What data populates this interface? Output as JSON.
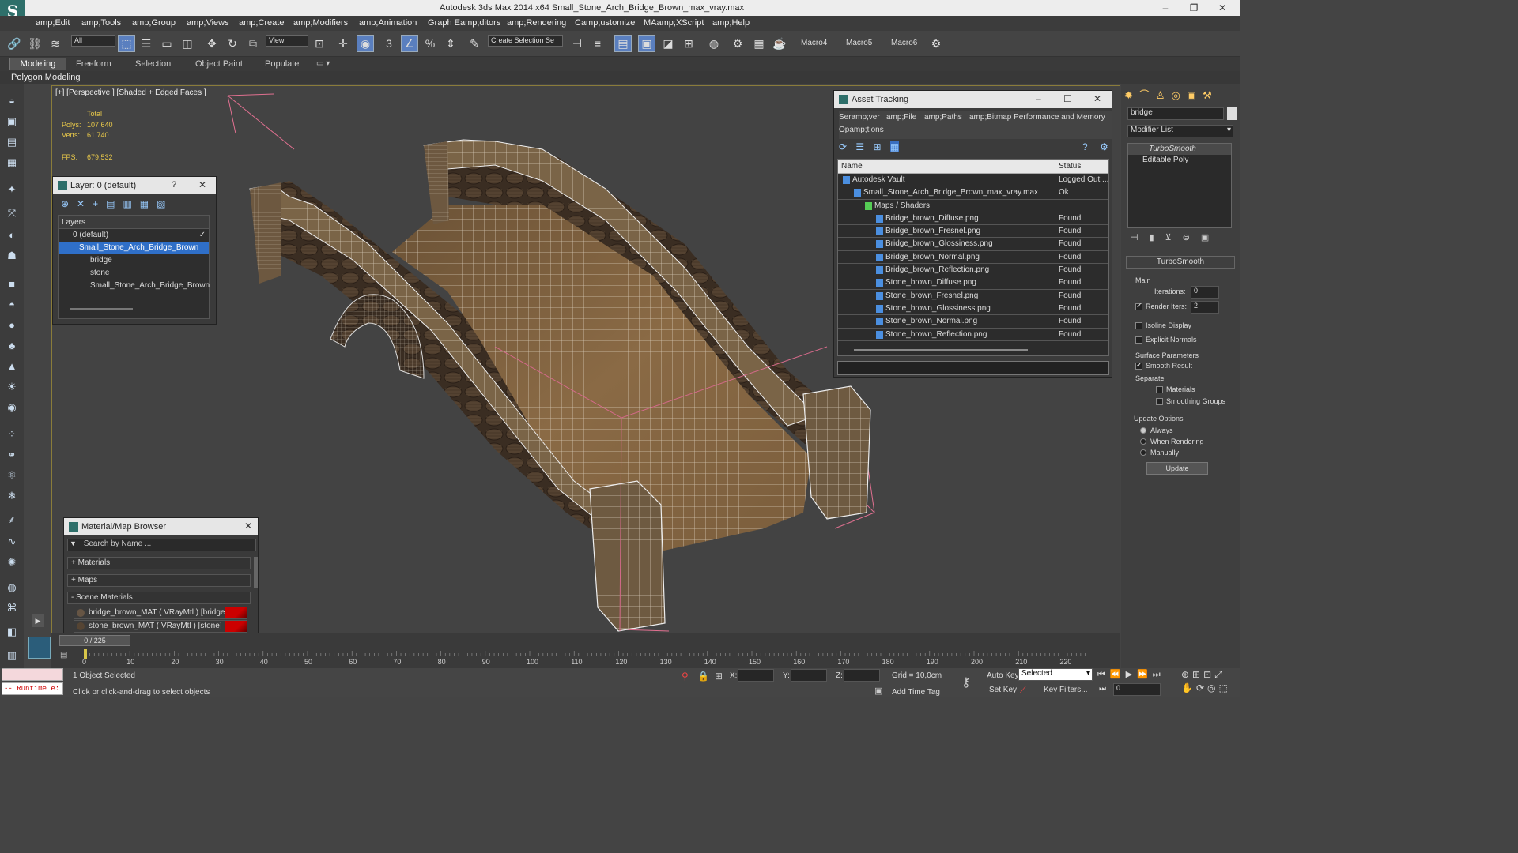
{
  "app": {
    "title": "Autodesk 3ds Max  2014 x64     Small_Stone_Arch_Bridge_Brown_max_vray.max"
  },
  "menu": [
    "amp;Edit",
    "amp;Tools",
    "amp;Group",
    "amp;Views",
    "amp;Create",
    "amp;Modifiers",
    "amp;Animation",
    "Graph Eamp;ditors",
    "amp;Rendering",
    "Camp;ustomize",
    "MAamp;XScript",
    "amp;Help"
  ],
  "toolbar": {
    "selection_filter": "All",
    "ref_coord": "View",
    "named_selection": "Create Selection Se",
    "macros": [
      "Macro4",
      "Macro5",
      "Macro6"
    ]
  },
  "ribbon": {
    "tabs": [
      "Modeling",
      "Freeform",
      "Selection",
      "Object Paint",
      "Populate"
    ],
    "sub": "Polygon Modeling"
  },
  "viewport": {
    "label": "[+] [Perspective ] [Shaded + Edged Faces ]",
    "total": "Total",
    "polys_label": "Polys:",
    "polys": "107 640",
    "verts_label": "Verts:",
    "verts": "61 740",
    "fps_label": "FPS:",
    "fps": "679,532"
  },
  "layer_dialog": {
    "title": "Layer: 0 (default)",
    "help": "?",
    "header": "Layers",
    "items": [
      "0 (default)",
      "Small_Stone_Arch_Bridge_Brown",
      "bridge",
      "stone",
      "Small_Stone_Arch_Bridge_Brown"
    ]
  },
  "material_browser": {
    "title": "Material/Map Browser",
    "search": "Search by Name ...",
    "groups": [
      "+ Materials",
      "+ Maps",
      "- Scene Materials"
    ],
    "materials": [
      "bridge_brown_MAT ( VRayMtl ) [bridge]",
      "stone_brown_MAT ( VRayMtl ) [stone]"
    ]
  },
  "asset_tracking": {
    "title": "Asset Tracking",
    "menu1": [
      "Seramp;ver",
      "amp;File",
      "amp;Paths",
      "amp;Bitmap Performance and Memory"
    ],
    "menu2": "Opamp;tions",
    "col_name": "Name",
    "col_status": "Status",
    "rows": [
      {
        "name": "Autodesk Vault",
        "status": "Logged Out ..."
      },
      {
        "name": "Small_Stone_Arch_Bridge_Brown_max_vray.max",
        "status": "Ok"
      },
      {
        "name": "Maps / Shaders",
        "status": ""
      },
      {
        "name": "Bridge_brown_Diffuse.png",
        "status": "Found"
      },
      {
        "name": "Bridge_brown_Fresnel.png",
        "status": "Found"
      },
      {
        "name": "Bridge_brown_Glossiness.png",
        "status": "Found"
      },
      {
        "name": "Bridge_brown_Normal.png",
        "status": "Found"
      },
      {
        "name": "Bridge_brown_Reflection.png",
        "status": "Found"
      },
      {
        "name": "Stone_brown_Diffuse.png",
        "status": "Found"
      },
      {
        "name": "Stone_brown_Fresnel.png",
        "status": "Found"
      },
      {
        "name": "Stone_brown_Glossiness.png",
        "status": "Found"
      },
      {
        "name": "Stone_brown_Normal.png",
        "status": "Found"
      },
      {
        "name": "Stone_brown_Reflection.png",
        "status": "Found"
      }
    ]
  },
  "command_panel": {
    "object_name": "bridge",
    "modifier_list": "Modifier List",
    "stack": [
      "TurboSmooth",
      "Editable Poly"
    ],
    "rollout": "TurboSmooth",
    "main": "Main",
    "iterations_label": "Iterations:",
    "iterations": "0",
    "render_iters_label": "Render Iters:",
    "render_iters": "2",
    "isoline": "Isoline Display",
    "explicit": "Explicit Normals",
    "surface": "Surface Parameters",
    "smooth_result": "Smooth Result",
    "separate": "Separate",
    "materials": "Materials",
    "smoothing_groups": "Smoothing Groups",
    "update_options": "Update Options",
    "always": "Always",
    "when_rendering": "When Rendering",
    "manually": "Manually",
    "update": "Update"
  },
  "timeline": {
    "frame": "0 / 225",
    "ticks": [
      "0",
      "10",
      "20",
      "30",
      "40",
      "50",
      "60",
      "70",
      "80",
      "90",
      "100",
      "110",
      "120",
      "130",
      "140",
      "150",
      "160",
      "170",
      "180",
      "190",
      "200",
      "210",
      "220"
    ]
  },
  "status": {
    "runtime": "-- Runtime e:",
    "selected": "1 Object Selected",
    "prompt": "Click or click-and-drag to select objects",
    "x": "X:",
    "y": "Y:",
    "z": "Z:",
    "grid": "Grid = 10,0cm",
    "add_time_tag": "Add Time Tag",
    "auto_key": "Auto Key",
    "set_key": "Set Key",
    "key_mode": "Selected",
    "key_filters": "Key Filters...",
    "frame_field": "0"
  }
}
